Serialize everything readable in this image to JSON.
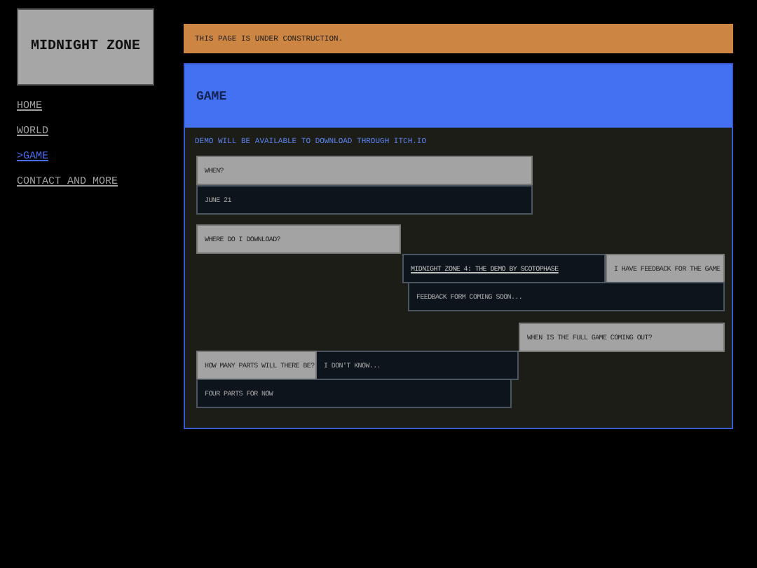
{
  "site_title": "MIDNIGHT ZONE",
  "nav": [
    {
      "label": "HOME",
      "selected": false
    },
    {
      "label": "WORLD",
      "selected": false
    },
    {
      "label": ">GAME",
      "selected": true
    },
    {
      "label": "CONTACT AND MORE",
      "selected": false
    }
  ],
  "notice": "THIS PAGE IS UNDER CONSTRUCTION.",
  "page_title": "GAME",
  "intro": "DEMO WILL BE AVAILABLE TO DOWNLOAD THROUGH ITCH.IO",
  "dialogs": [
    {
      "question": "WHEN?",
      "answer": "JUNE 21",
      "answer_is_link": false
    },
    {
      "question": "WHERE DO I DOWNLOAD?",
      "answer": "MIDNIGHT ZONE 4: THE DEMO BY SCOTOPHASE",
      "answer_is_link": true
    },
    {
      "question": "I HAVE FEEDBACK FOR THE GAME",
      "answer": "FEEDBACK FORM COMING SOON...",
      "answer_is_link": false
    },
    {
      "question": "WHEN IS THE FULL GAME COMING OUT?",
      "answer": "I DON'T KNOW...",
      "answer_is_link": false
    },
    {
      "question": "HOW MANY PARTS WILL THERE BE?",
      "answer": "FOUR PARTS FOR NOW",
      "answer_is_link": false
    }
  ]
}
